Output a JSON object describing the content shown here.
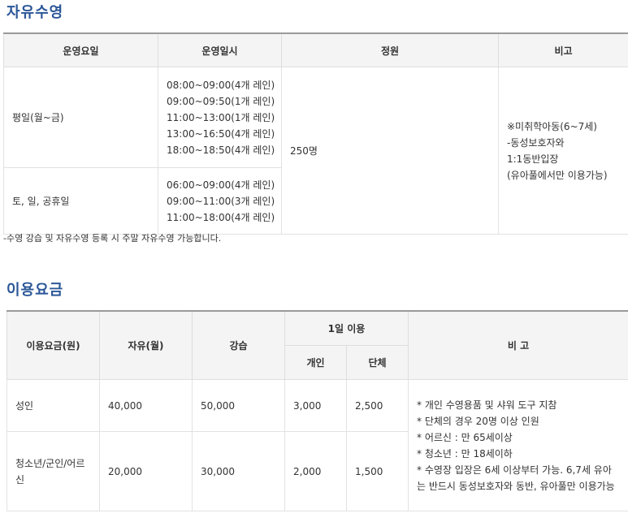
{
  "free_swim": {
    "title": "자유수영",
    "headers": [
      "운영요일",
      "운영일시",
      "정원",
      "비고"
    ],
    "rows": [
      {
        "day": "평일(월~금)",
        "times": [
          "08:00~09:00(4개 레인)",
          "09:00~09:50(1개 레인)",
          "11:00~13:00(1개 레인)",
          "13:00~16:50(4개 레인)",
          "18:00~18:50(4개 레인)"
        ]
      },
      {
        "day": "토, 일, 공휴일",
        "times": [
          "06:00~09:00(4개 레인)",
          "09:00~11:00(3개 레인)",
          "11:00~18:00(4개 레인)"
        ]
      }
    ],
    "capacity": "250명",
    "remarks": [
      "※미취학아동(6~7세)",
      "-동성보호자와",
      "1:1동반입장",
      "(유아풀에서만 이용가능)"
    ],
    "note": "-수영 강습 및 자유수영 등록 시 주말 자유수영 가능합니다."
  },
  "fee": {
    "title": "이용요금",
    "headers": {
      "type": "이용요금(원)",
      "free": "자유(월)",
      "lesson": "강습",
      "daily": "1일 이용",
      "individual": "개인",
      "group": "단체",
      "remarks": "비 고"
    },
    "rows": [
      {
        "type": "성인",
        "free": "40,000",
        "lesson": "50,000",
        "individual": "3,000",
        "group": "2,500"
      },
      {
        "type": "청소년/군인/어르신",
        "free": "20,000",
        "lesson": "30,000",
        "individual": "2,000",
        "group": "1,500"
      }
    ],
    "remarks": [
      "* 개인 수영용품 및 샤워 도구 지참",
      "* 단체의 경우 20명 이상 인원",
      "* 어르신 : 만 65세이상",
      "* 청소년 : 만 18세이하",
      "* 수영장 입장은 6세 이상부터 가능. 6,7세 유아는 반드시 동성보호자와 동반, 유아풀만 이용가능"
    ]
  }
}
